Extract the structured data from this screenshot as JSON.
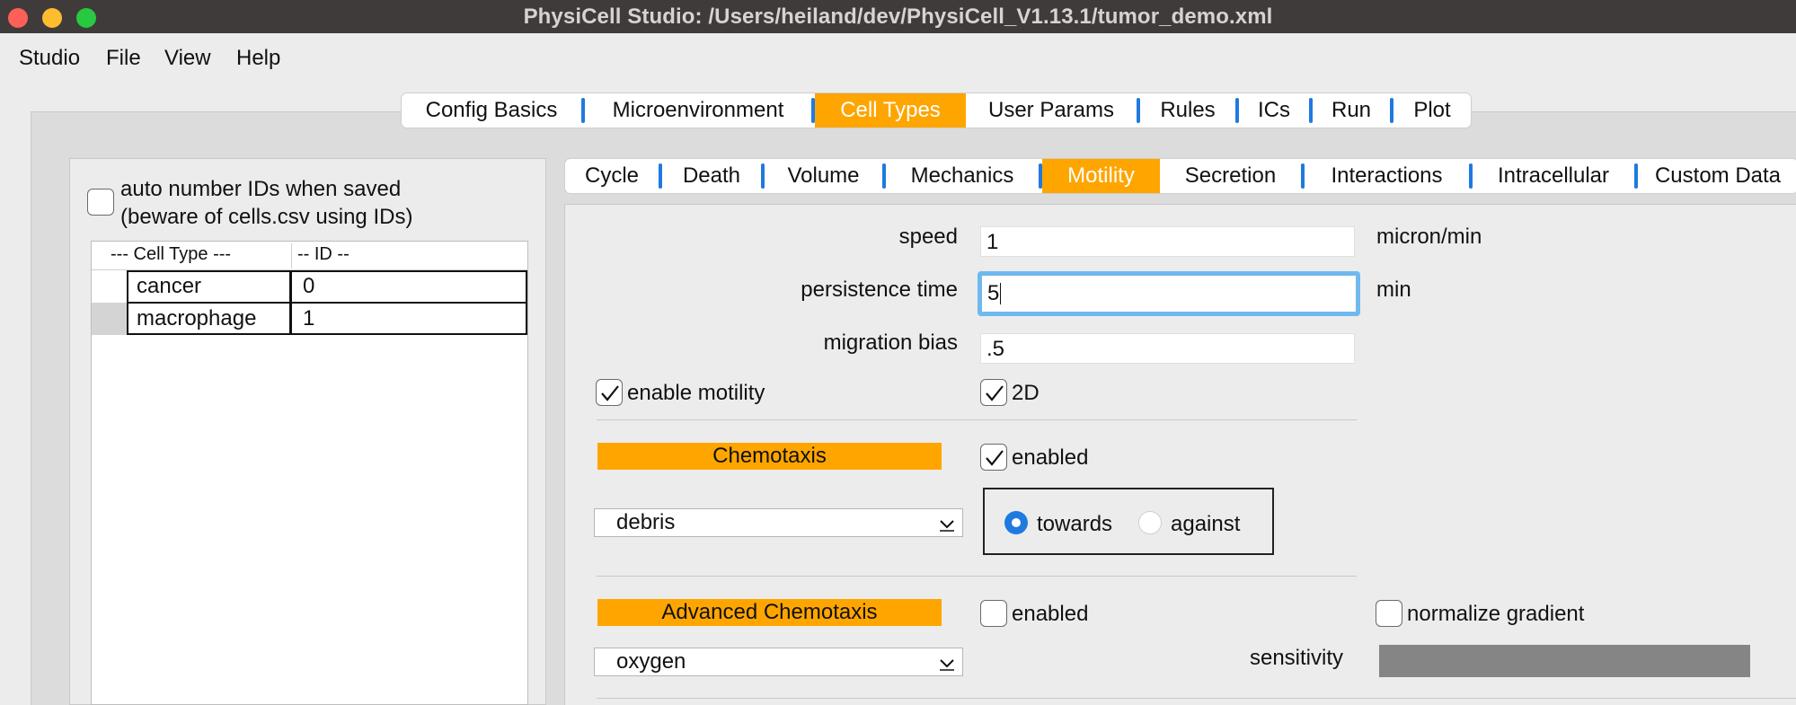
{
  "window": {
    "title": "PhysiCell Studio: /Users/heiland/dev/PhysiCell_V1.13.1/tumor_demo.xml",
    "colors": {
      "close": "#fe5f57",
      "minimize": "#febc2e",
      "zoom": "#28c840",
      "accent": "#fea500",
      "focus": "#1f7ae0"
    }
  },
  "menu": [
    "Studio",
    "File",
    "View",
    "Help"
  ],
  "top_tabs": [
    "Config Basics",
    "Microenvironment",
    "Cell Types",
    "User Params",
    "Rules",
    "ICs",
    "Run",
    "Plot"
  ],
  "top_tabs_active": "Cell Types",
  "left": {
    "auto_number_line1": "auto number IDs when saved",
    "auto_number_line2": "(beware of cells.csv using IDs)",
    "table_headers": [
      "---  Cell Type ---",
      "-- ID --"
    ],
    "rows": [
      {
        "name": "cancer",
        "id": "0"
      },
      {
        "name": "macrophage",
        "id": "1"
      }
    ]
  },
  "sub_tabs": [
    "Cycle",
    "Death",
    "Volume",
    "Mechanics",
    "Motility",
    "Secretion",
    "Interactions",
    "Intracellular",
    "Custom Data"
  ],
  "sub_tabs_active": "Motility",
  "motility": {
    "speed_label": "speed",
    "speed_value": "1",
    "speed_unit": "micron/min",
    "persistence_label": "persistence time",
    "persistence_value": "5",
    "persistence_unit": "min",
    "bias_label": "migration bias",
    "bias_value": ".5",
    "enable_motility_label": "enable motility",
    "enable_motility_checked": true,
    "two_d_label": "2D",
    "two_d_checked": true
  },
  "chemotaxis": {
    "button_label": "Chemotaxis",
    "enabled_label": "enabled",
    "enabled_checked": true,
    "substrate": "debris",
    "towards_label": "towards",
    "against_label": "against",
    "direction": "towards"
  },
  "advanced": {
    "button_label": "Advanced Chemotaxis",
    "enabled_label": "enabled",
    "enabled_checked": false,
    "normalize_label": "normalize gradient",
    "normalize_checked": false,
    "substrate": "oxygen",
    "sensitivity_label": "sensitivity"
  }
}
